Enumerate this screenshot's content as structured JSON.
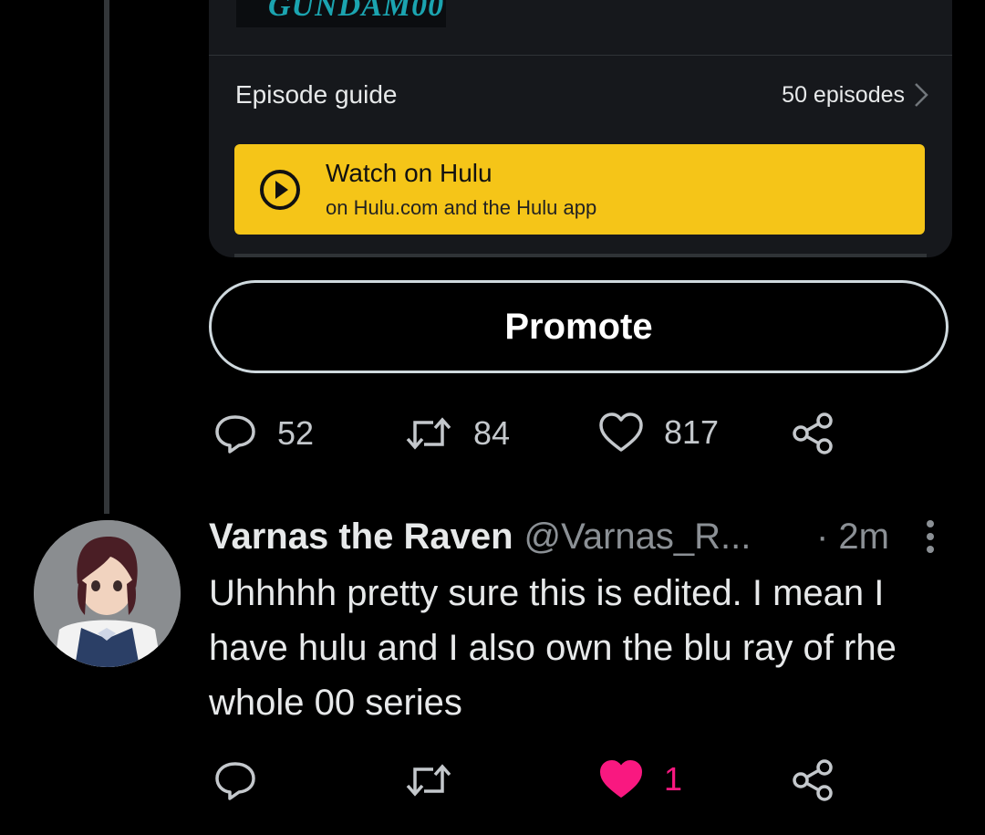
{
  "card": {
    "thumb_logo_text": "GUNDAM00",
    "episode_guide_label": "Episode guide",
    "episode_count": "50 episodes",
    "watch_title": "Watch on Hulu",
    "watch_subtitle": "on Hulu.com and the Hulu app",
    "accent_color": "#f5c518"
  },
  "promote_label": "Promote",
  "tweet_actions": {
    "reply_count": "52",
    "retweet_count": "84",
    "like_count": "817"
  },
  "reply": {
    "display_name": "Varnas the Raven",
    "handle": "@Varnas_R...",
    "time": "· 2m",
    "text": "Uhhhhh pretty sure this is edited. I mean I have hulu and I also own the blu ray of rhe whole 00 series",
    "like_count": "1",
    "like_color": "#f91880"
  },
  "icons": [
    "chevron-right-icon",
    "play-circle-icon",
    "reply-icon",
    "retweet-icon",
    "like-icon",
    "share-icon",
    "more-icon"
  ]
}
